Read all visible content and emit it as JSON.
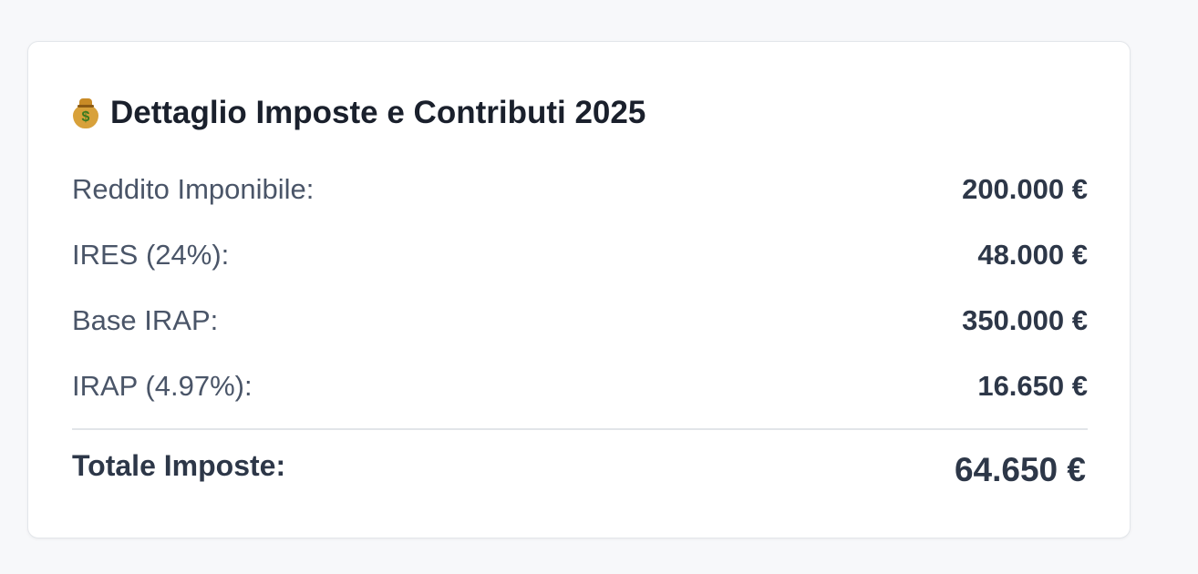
{
  "card": {
    "icon": "money-bag-icon",
    "title": "Dettaglio Imposte e Contributi 2025"
  },
  "rows": [
    {
      "label": "Reddito Imponibile:",
      "value": "200.000 €"
    },
    {
      "label": "IRES (24%):",
      "value": "48.000 €"
    },
    {
      "label": "Base IRAP:",
      "value": "350.000 €"
    },
    {
      "label": "IRAP (4.97%):",
      "value": "16.650 €"
    }
  ],
  "total": {
    "label": "Totale Imposte:",
    "value": "64.650 €"
  },
  "colors": {
    "background": "#f7f8fa",
    "card": "#ffffff",
    "title": "#1a202c",
    "label": "#4a5568",
    "value": "#2d3748"
  }
}
